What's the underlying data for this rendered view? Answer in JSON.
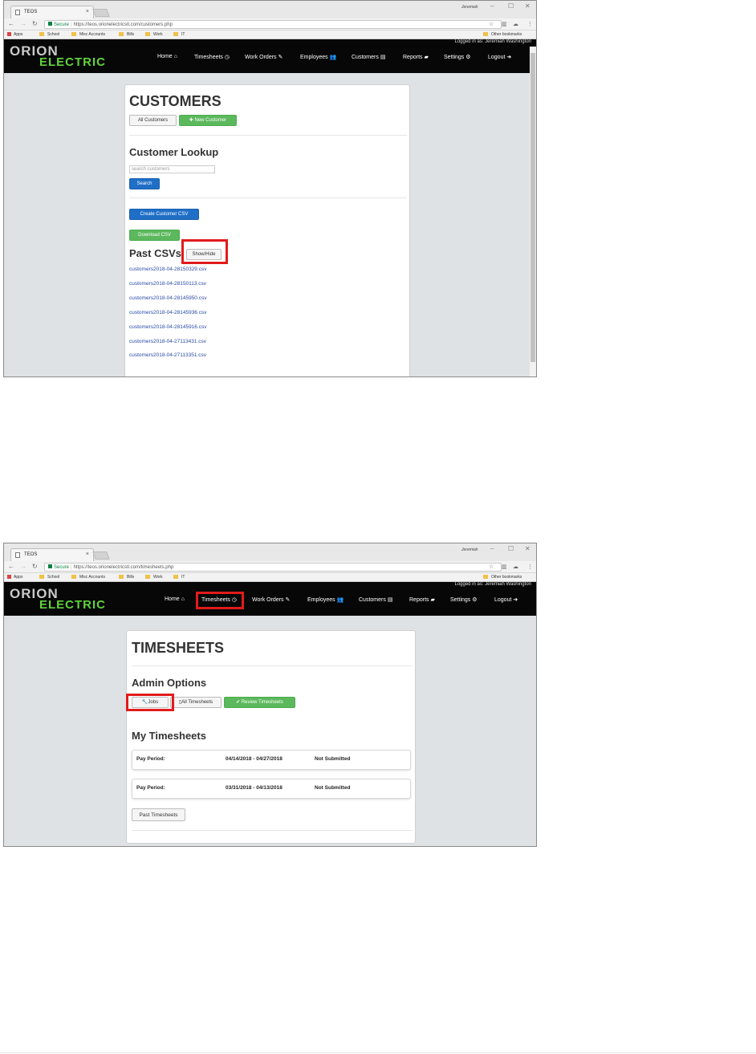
{
  "browser": {
    "tab_title": "TEOS",
    "tab_close": "×",
    "window_user": "Jeremiah",
    "secure_label": "Secure",
    "bookmarks": [
      "Apps",
      "School",
      "Misc Accounts",
      "Bills",
      "Work",
      "IT"
    ],
    "other_bookmarks": "Other bookmarks"
  },
  "site": {
    "logo_top": "ORION",
    "logo_bottom": "ELECTRIC",
    "logged_in": "Logged in as: Jeremiah Washington",
    "nav": {
      "home": "Home",
      "timesheets": "Timesheets",
      "work_orders": "Work Orders",
      "employees": "Employees",
      "customers": "Customers",
      "reports": "Reports",
      "settings": "Settings",
      "logout": "Logout"
    }
  },
  "customers_page": {
    "url": "https://teos.orionelectricstl.com/customers.php",
    "title": "CUSTOMERS",
    "all_customers_btn": "All Customers",
    "new_customer_btn": "New Customer",
    "lookup_heading": "Customer Lookup",
    "search_placeholder": "search customers",
    "search_btn": "Search",
    "create_csv_btn": "Create Customer CSV",
    "download_csv_btn": "Download CSV",
    "past_csvs_heading": "Past CSVs",
    "show_hide_btn": "Show/Hide",
    "csv_files": [
      "customers2018-04-28150329.csv",
      "customers2018-04-28150113.csv",
      "customers2018-04-28145950.csv",
      "customers2018-04-28145936.csv",
      "customers2018-04-28145916.csv",
      "customers2018-04-27113431.csv",
      "customers2018-04-27113351.csv"
    ]
  },
  "timesheets_page": {
    "url": "https://teos.orionelectricstl.com/timesheets.php",
    "title": "TIMESHEETS",
    "admin_heading": "Admin Options",
    "jobs_btn": "Jobs",
    "all_timesheets_btn": "All Timesheets",
    "review_btn": "Review Timesheets",
    "my_heading": "My Timesheets",
    "pay_periods": [
      {
        "label": "Pay Period:",
        "range": "04/14/2018 - 04/27/2018",
        "status": "Not Submitted"
      },
      {
        "label": "Pay Period:",
        "range": "03/31/2018 - 04/13/2018",
        "status": "Not Submitted"
      }
    ],
    "past_btn": "Past Timesheets"
  },
  "colors": {
    "highlight": "#e21b1b",
    "green_button": "#5cb85c",
    "blue_button": "#1f6fc7",
    "logo_green": "#5fd33a",
    "header_bg": "#070707"
  }
}
